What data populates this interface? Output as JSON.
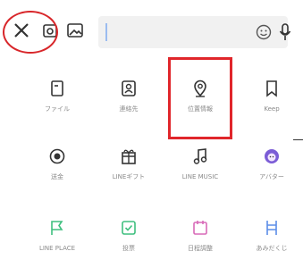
{
  "header": {
    "search_placeholder": ""
  },
  "menu": {
    "row1": [
      {
        "label": "ファイル",
        "icon": "file-icon"
      },
      {
        "label": "連絡先",
        "icon": "contact-icon"
      },
      {
        "label": "位置情報",
        "icon": "location-pin-icon"
      },
      {
        "label": "Keep",
        "icon": "bookmark-icon"
      }
    ],
    "row2": [
      {
        "label": "送金",
        "icon": "coin-icon"
      },
      {
        "label": "LINEギフト",
        "icon": "gift-icon"
      },
      {
        "label": "LINE MUSIC",
        "icon": "music-note-icon"
      },
      {
        "label": "アバター",
        "icon": "avatar-icon"
      }
    ],
    "row3": [
      {
        "label": "LINE PLACE",
        "icon": "flag-icon"
      },
      {
        "label": "投票",
        "icon": "vote-icon"
      },
      {
        "label": "日程調整",
        "icon": "calendar-icon"
      },
      {
        "label": "あみだくじ",
        "icon": "ladder-icon"
      }
    ]
  },
  "colors": {
    "highlight": "#e0262b",
    "icon_dark": "#333333",
    "icon_purple": "#7b5cd6",
    "icon_green": "#3fbf7f",
    "icon_pink": "#d86ab8",
    "icon_blue": "#5b8de8"
  }
}
